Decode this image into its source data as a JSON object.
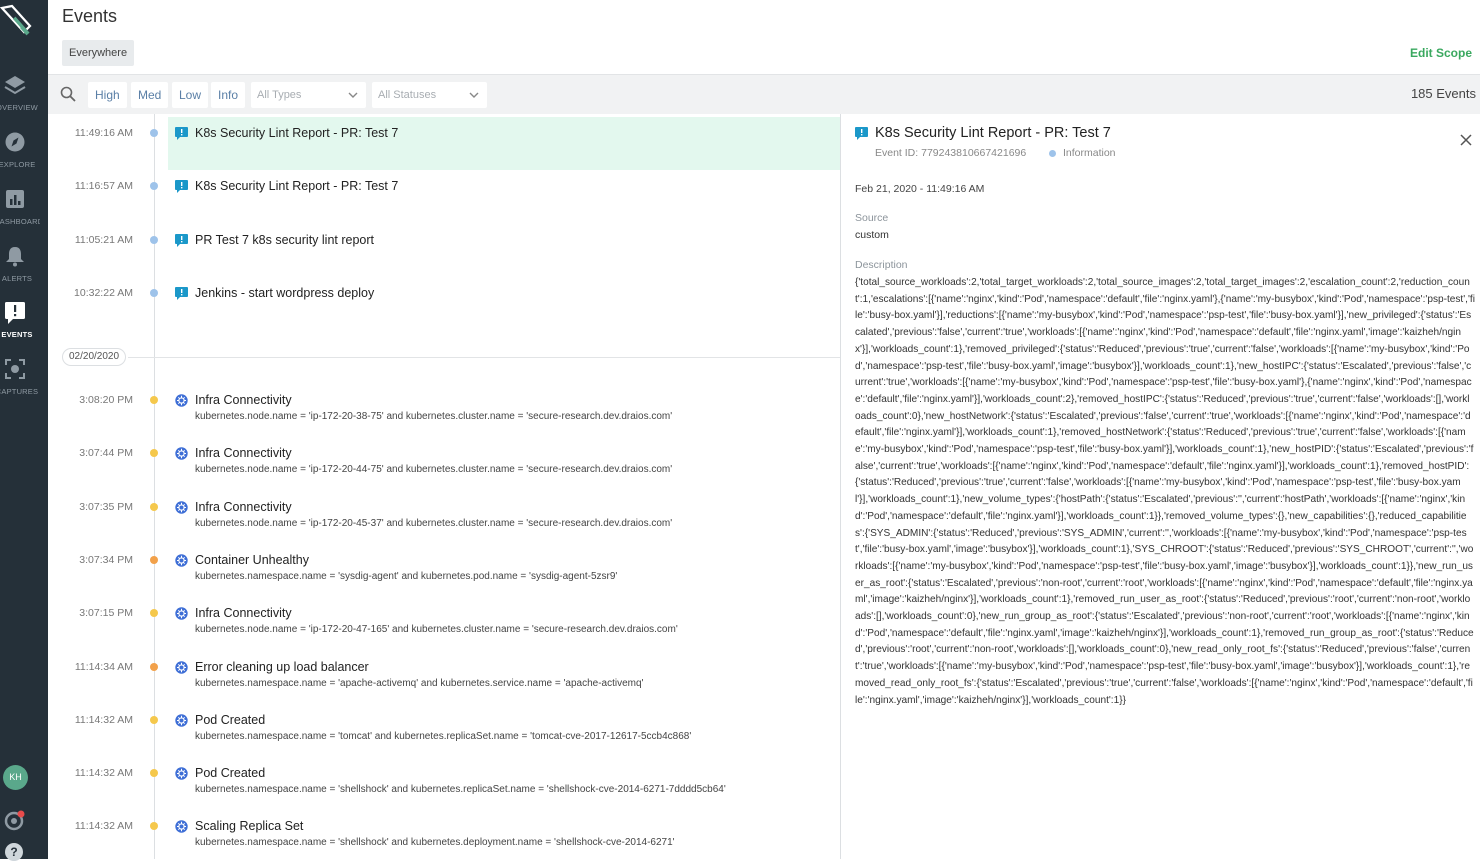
{
  "app": {
    "logo": "sysdig-shovel-logo"
  },
  "sidebar": {
    "items": [
      {
        "label": "OVERVIEW",
        "icon": "layers-icon",
        "active": false
      },
      {
        "label": "EXPLORE",
        "icon": "compass-icon",
        "active": false
      },
      {
        "label": "DASHBOARDS",
        "icon": "dashboard-icon",
        "active": false
      },
      {
        "label": "ALERTS",
        "icon": "bell-icon",
        "active": false
      },
      {
        "label": "EVENTS",
        "icon": "events-flag-icon",
        "active": true
      },
      {
        "label": "CAPTURES",
        "icon": "capture-icon",
        "active": false
      }
    ],
    "avatar": "KH"
  },
  "header": {
    "title": "Events",
    "scope": "Everywhere",
    "edit_scope": "Edit Scope"
  },
  "filters": {
    "severities": [
      "High",
      "Med",
      "Low",
      "Info"
    ],
    "types_placeholder": "All Types",
    "statuses_placeholder": "All Statuses",
    "count": "185 Events"
  },
  "colors": {
    "accent": "#3aa85f",
    "sidebar_bg": "#253039",
    "info_dot": "#9ec3ea",
    "warn_dot": "#f5c84c",
    "orange_dot": "#f2a14a",
    "selected_bg": "#e3f8ee",
    "kube_icon": "#3f6fd6",
    "custom_icon": "#1b98c9"
  },
  "events": [
    {
      "time": "11:49:16 AM",
      "title": "K8s Security Lint Report - PR: Test 7",
      "desc": "",
      "icon": "custom-event-flag-icon",
      "severity": "info",
      "selected": true
    },
    {
      "time": "11:16:57 AM",
      "title": "K8s Security Lint Report - PR: Test 7",
      "desc": "",
      "icon": "custom-event-flag-icon",
      "severity": "info",
      "selected": false
    },
    {
      "time": "11:05:21 AM",
      "title": "PR Test 7 k8s security lint report",
      "desc": "",
      "icon": "custom-event-flag-icon",
      "severity": "info",
      "selected": false
    },
    {
      "time": "10:32:22 AM",
      "title": "Jenkins - start wordpress deploy",
      "desc": "",
      "icon": "custom-event-flag-icon",
      "severity": "info",
      "selected": false
    }
  ],
  "date_separator": "02/20/2020",
  "events2": [
    {
      "time": "3:08:20 PM",
      "title": "Infra Connectivity",
      "desc": "kubernetes.node.name = 'ip-172-20-38-75' and kubernetes.cluster.name = 'secure-research.dev.draios.com'",
      "icon": "kubernetes-icon",
      "severity": "low"
    },
    {
      "time": "3:07:44 PM",
      "title": "Infra Connectivity",
      "desc": "kubernetes.node.name = 'ip-172-20-44-75' and kubernetes.cluster.name = 'secure-research.dev.draios.com'",
      "icon": "kubernetes-icon",
      "severity": "low"
    },
    {
      "time": "3:07:35 PM",
      "title": "Infra Connectivity",
      "desc": "kubernetes.node.name = 'ip-172-20-45-37' and kubernetes.cluster.name = 'secure-research.dev.draios.com'",
      "icon": "kubernetes-icon",
      "severity": "low"
    },
    {
      "time": "3:07:34 PM",
      "title": "Container Unhealthy",
      "desc": "kubernetes.namespace.name = 'sysdig-agent' and kubernetes.pod.name = 'sysdig-agent-5zsr9'",
      "icon": "kubernetes-icon",
      "severity": "medium"
    },
    {
      "time": "3:07:15 PM",
      "title": "Infra Connectivity",
      "desc": "kubernetes.node.name = 'ip-172-20-47-165' and kubernetes.cluster.name = 'secure-research.dev.draios.com'",
      "icon": "kubernetes-icon",
      "severity": "low"
    },
    {
      "time": "11:14:34 AM",
      "title": "Error cleaning up load balancer",
      "desc": "kubernetes.namespace.name = 'apache-activemq' and kubernetes.service.name = 'apache-activemq'",
      "icon": "kubernetes-icon",
      "severity": "medium"
    },
    {
      "time": "11:14:32 AM",
      "title": "Pod Created",
      "desc": "kubernetes.namespace.name = 'tomcat' and kubernetes.replicaSet.name = 'tomcat-cve-2017-12617-5ccb4c868'",
      "icon": "kubernetes-icon",
      "severity": "low"
    },
    {
      "time": "11:14:32 AM",
      "title": "Pod Created",
      "desc": "kubernetes.namespace.name = 'shellshock' and kubernetes.replicaSet.name = 'shellshock-cve-2014-6271-7dddd5cb64'",
      "icon": "kubernetes-icon",
      "severity": "low"
    },
    {
      "time": "11:14:32 AM",
      "title": "Scaling Replica Set",
      "desc": "kubernetes.namespace.name = 'shellshock' and kubernetes.deployment.name = 'shellshock-cve-2014-6271'",
      "icon": "kubernetes-icon",
      "severity": "low"
    }
  ],
  "detail": {
    "title": "K8s Security Lint Report - PR: Test 7",
    "event_id": "Event ID: 779243810667421696",
    "severity": "Information",
    "timestamp": "Feb 21, 2020 - 11:49:16 AM",
    "source_label": "Source",
    "source": "custom",
    "description_label": "Description",
    "description": "{'total_source_workloads':2,'total_target_workloads':2,'total_source_images':2,'total_target_images':2,'escalation_count':2,'reduction_count':1,'escalations':[{'name':'nginx','kind':'Pod','namespace':'default','file':'nginx.yaml'},{'name':'my-busybox','kind':'Pod','namespace':'psp-test','file':'busy-box.yaml'}],'reductions':[{'name':'my-busybox','kind':'Pod','namespace':'psp-test','file':'busy-box.yaml'}],'new_privileged':{'status':'Escalated','previous':'false','current':'true','workloads':[{'name':'nginx','kind':'Pod','namespace':'default','file':'nginx.yaml','image':'kaizheh/nginx'}],'workloads_count':1},'removed_privileged':{'status':'Reduced','previous':'true','current':'false','workloads':[{'name':'my-busybox','kind':'Pod','namespace':'psp-test','file':'busy-box.yaml','image':'busybox'}],'workloads_count':1},'new_hostIPC':{'status':'Escalated','previous':'false','current':'true','workloads':[{'name':'my-busybox','kind':'Pod','namespace':'psp-test','file':'busy-box.yaml'},{'name':'nginx','kind':'Pod','namespace':'default','file':'nginx.yaml'}],'workloads_count':2},'removed_hostIPC':{'status':'Reduced','previous':'true','current':'false','workloads':[],'workloads_count':0},'new_hostNetwork':{'status':'Escalated','previous':'false','current':'true','workloads':[{'name':'nginx','kind':'Pod','namespace':'default','file':'nginx.yaml'}],'workloads_count':1},'removed_hostNetwork':{'status':'Reduced','previous':'true','current':'false','workloads':[{'name':'my-busybox','kind':'Pod','namespace':'psp-test','file':'busy-box.yaml'}],'workloads_count':1},'new_hostPID':{'status':'Escalated','previous':'false','current':'true','workloads':[{'name':'nginx','kind':'Pod','namespace':'default','file':'nginx.yaml'}],'workloads_count':1},'removed_hostPID':{'status':'Reduced','previous':'true','current':'false','workloads':[{'name':'my-busybox','kind':'Pod','namespace':'psp-test','file':'busy-box.yaml'}],'workloads_count':1},'new_volume_types':{'hostPath':{'status':'Escalated','previous':'','current':'hostPath','workloads':[{'name':'nginx','kind':'Pod','namespace':'default','file':'nginx.yaml'}],'workloads_count':1}},'removed_volume_types':{},'new_capabilities':{},'reduced_capabilities':{'SYS_ADMIN':{'status':'Reduced','previous':'SYS_ADMIN','current':'','workloads':[{'name':'my-busybox','kind':'Pod','namespace':'psp-test','file':'busy-box.yaml','image':'busybox'}],'workloads_count':1},'SYS_CHROOT':{'status':'Reduced','previous':'SYS_CHROOT','current':'','workloads':[{'name':'my-busybox','kind':'Pod','namespace':'psp-test','file':'busy-box.yaml','image':'busybox'}],'workloads_count':1}},'new_run_user_as_root':{'status':'Escalated','previous':'non-root','current':'root','workloads':[{'name':'nginx','kind':'Pod','namespace':'default','file':'nginx.yaml','image':'kaizheh/nginx'}],'workloads_count':1},'removed_run_user_as_root':{'status':'Reduced','previous':'root','current':'non-root','workloads':[],'workloads_count':0},'new_run_group_as_root':{'status':'Escalated','previous':'non-root','current':'root','workloads':[{'name':'nginx','kind':'Pod','namespace':'default','file':'nginx.yaml','image':'kaizheh/nginx'}],'workloads_count':1},'removed_run_group_as_root':{'status':'Reduced','previous':'root','current':'non-root','workloads':[],'workloads_count':0},'new_read_only_root_fs':{'status':'Reduced','previous':'false','current':'true','workloads':[{'name':'my-busybox','kind':'Pod','namespace':'psp-test','file':'busy-box.yaml','image':'busybox'}],'workloads_count':1},'removed_read_only_root_fs':{'status':'Escalated','previous':'true','current':'false','workloads':[{'name':'nginx','kind':'Pod','namespace':'default','file':'nginx.yaml','image':'kaizheh/nginx'}],'workloads_count':1}}"
  }
}
